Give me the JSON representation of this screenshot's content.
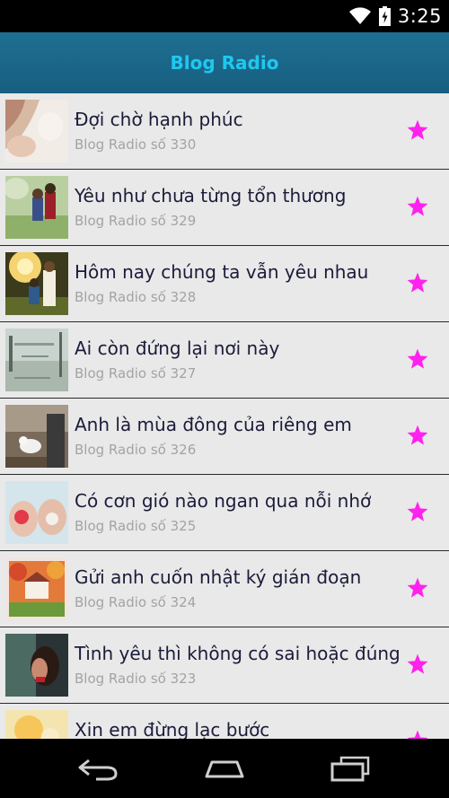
{
  "status_bar": {
    "time": "3:25",
    "icons": [
      "wifi-icon",
      "battery-charging-icon"
    ]
  },
  "app_bar": {
    "title": "Blog Radio"
  },
  "colors": {
    "app_bar_bg": "#1b6a8c",
    "title_color": "#1ec8f0",
    "star_color": "#ff22ee",
    "list_bg": "#e9e9e9"
  },
  "items": [
    {
      "title": "Đợi chờ hạnh phúc",
      "subtitle": "Blog Radio số 330",
      "icon": "star-icon"
    },
    {
      "title": "Yêu như chưa từng tổn thương",
      "subtitle": "Blog Radio số 329",
      "icon": "star-icon"
    },
    {
      "title": "Hôm nay chúng ta vẫn yêu nhau",
      "subtitle": "Blog Radio số 328",
      "icon": "star-icon"
    },
    {
      "title": "Ai còn đứng lại nơi này",
      "subtitle": "Blog Radio số 327",
      "icon": "star-icon"
    },
    {
      "title": "Anh là mùa đông của riêng em",
      "subtitle": "Blog Radio số 326",
      "icon": "star-icon"
    },
    {
      "title": "Có cơn gió nào ngan qua nỗi nhớ",
      "subtitle": "Blog Radio số 325",
      "icon": "star-icon"
    },
    {
      "title": "Gửi anh cuốn nhật ký gián đoạn",
      "subtitle": "Blog Radio số 324",
      "icon": "star-icon"
    },
    {
      "title": "Tình yêu thì không có sai hoặc đúng",
      "subtitle": "Blog Radio số 323",
      "icon": "star-icon"
    },
    {
      "title": "Xin em đừng lạc bước",
      "subtitle": "",
      "icon": "star-icon"
    }
  ],
  "nav_bar": {
    "icons": [
      "back-icon",
      "home-icon",
      "recents-icon"
    ]
  }
}
